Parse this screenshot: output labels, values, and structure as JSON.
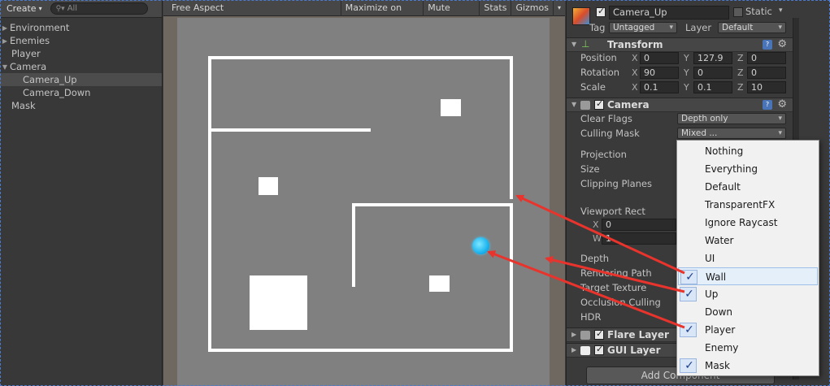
{
  "hierarchy": {
    "create_label": "Create",
    "search_placeholder": "All",
    "items": [
      {
        "label": "Environment",
        "expandable": true
      },
      {
        "label": "Enemies",
        "expandable": true
      },
      {
        "label": "Player",
        "expandable": false
      },
      {
        "label": "Camera",
        "expandable": true,
        "expanded": true
      },
      {
        "label": "Camera_Up",
        "child": true,
        "selected": true
      },
      {
        "label": "Camera_Down",
        "child": true
      },
      {
        "label": "Mask",
        "expandable": false
      }
    ]
  },
  "game": {
    "aspect_label": "Free Aspect",
    "maximize_label": "Maximize on Play",
    "mute_label": "Mute audio",
    "stats_label": "Stats",
    "gizmos_label": "Gizmos"
  },
  "inspector": {
    "object_name": "Camera_Up",
    "static_label": "Static",
    "tag_label": "Tag",
    "tag_value": "Untagged",
    "layer_label": "Layer",
    "layer_value": "Default",
    "transform": {
      "title": "Transform",
      "position_label": "Position",
      "rotation_label": "Rotation",
      "scale_label": "Scale",
      "position": {
        "x": "0",
        "y": "127.9",
        "z": "0"
      },
      "rotation": {
        "x": "90",
        "y": "0",
        "z": "0"
      },
      "scale": {
        "x": "0.1",
        "y": "0.1",
        "z": "10"
      }
    },
    "camera": {
      "title": "Camera",
      "clear_flags_label": "Clear Flags",
      "clear_flags_value": "Depth only",
      "culling_mask_label": "Culling Mask",
      "culling_mask_value": "Mixed ...",
      "projection_label": "Projection",
      "size_label": "Size",
      "clipping_label": "Clipping Planes",
      "viewport_label": "Viewport Rect",
      "viewport_x_label": "X",
      "viewport_x_value": "0",
      "viewport_w_label": "W",
      "viewport_w_value": "1",
      "depth_label": "Depth",
      "rendering_path_label": "Rendering Path",
      "target_texture_label": "Target Texture",
      "occlusion_label": "Occlusion Culling",
      "hdr_label": "HDR"
    },
    "flare_layer_title": "Flare Layer",
    "gui_layer_title": "GUI Layer",
    "add_component_label": "Add Component"
  },
  "culling_mask_menu": [
    {
      "label": "Nothing",
      "checked": false
    },
    {
      "label": "Everything",
      "checked": false
    },
    {
      "label": "Default",
      "checked": false
    },
    {
      "label": "TransparentFX",
      "checked": false
    },
    {
      "label": "Ignore Raycast",
      "checked": false
    },
    {
      "label": "Water",
      "checked": false
    },
    {
      "label": "UI",
      "checked": false
    },
    {
      "label": "Wall",
      "checked": true
    },
    {
      "label": "Up",
      "checked": true
    },
    {
      "label": "Down",
      "checked": false
    },
    {
      "label": "Player",
      "checked": true
    },
    {
      "label": "Enemy",
      "checked": false
    },
    {
      "label": "Mask",
      "checked": true
    }
  ],
  "colors": {
    "annotation_arrow": "#e8342c",
    "player_ball": "#1cb4ee",
    "viewport_bg": "#808080"
  }
}
